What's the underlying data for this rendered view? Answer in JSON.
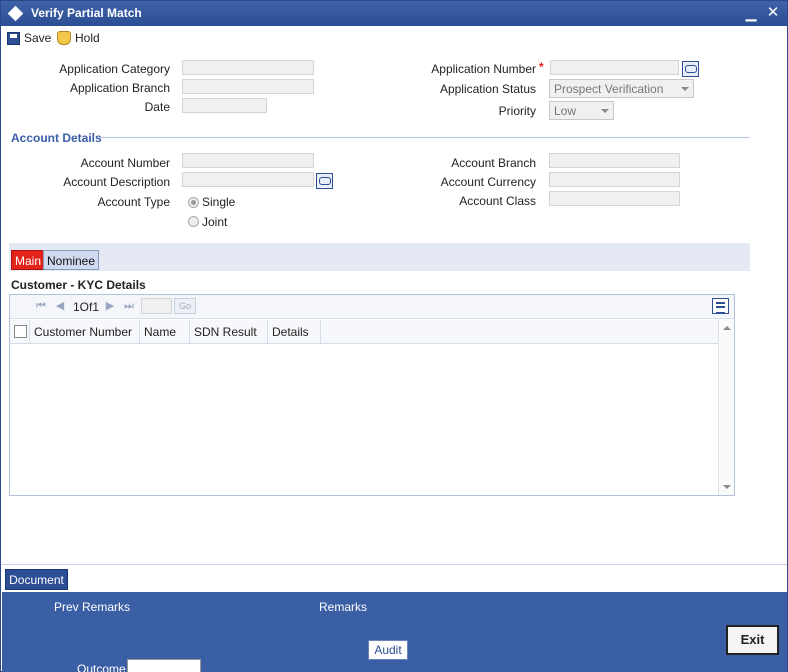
{
  "window": {
    "title": "Verify Partial Match",
    "minimize": "▁",
    "close": "✕"
  },
  "toolbar": {
    "save_label": "Save",
    "hold_label": "Hold"
  },
  "form": {
    "application_category_label": "Application Category",
    "application_branch_label": "Application Branch",
    "date_label": "Date",
    "application_number_label": "Application Number",
    "required_mark": "*",
    "application_status_label": "Application Status",
    "application_status_value": "Prospect Verification",
    "priority_label": "Priority",
    "priority_value": "Low"
  },
  "account": {
    "section_title": "Account Details",
    "account_number_label": "Account Number",
    "account_description_label": "Account Description",
    "account_type_label": "Account Type",
    "type_single": "Single",
    "type_joint": "Joint",
    "selected_type": "Single",
    "account_branch_label": "Account Branch",
    "account_currency_label": "Account Currency",
    "account_class_label": "Account Class"
  },
  "tabs": [
    {
      "label": "Main",
      "active": true
    },
    {
      "label": "Nominee",
      "active": false
    }
  ],
  "kyc": {
    "title": "Customer - KYC Details",
    "pager_text": "1Of1",
    "go_label": "Go",
    "columns": [
      "Customer Number",
      "Name",
      "SDN Result",
      "Details"
    ],
    "rows": []
  },
  "bottom": {
    "document_label": "Document",
    "prev_remarks_label": "Prev Remarks",
    "remarks_label": "Remarks",
    "audit_label": "Audit",
    "outcome_label": "Outcome",
    "exit_label": "Exit"
  },
  "colors": {
    "title_bar": "#2b4d93",
    "footer": "#3b5fa5",
    "active_tab": "#e2231a",
    "section_title": "#3a5ea8"
  }
}
